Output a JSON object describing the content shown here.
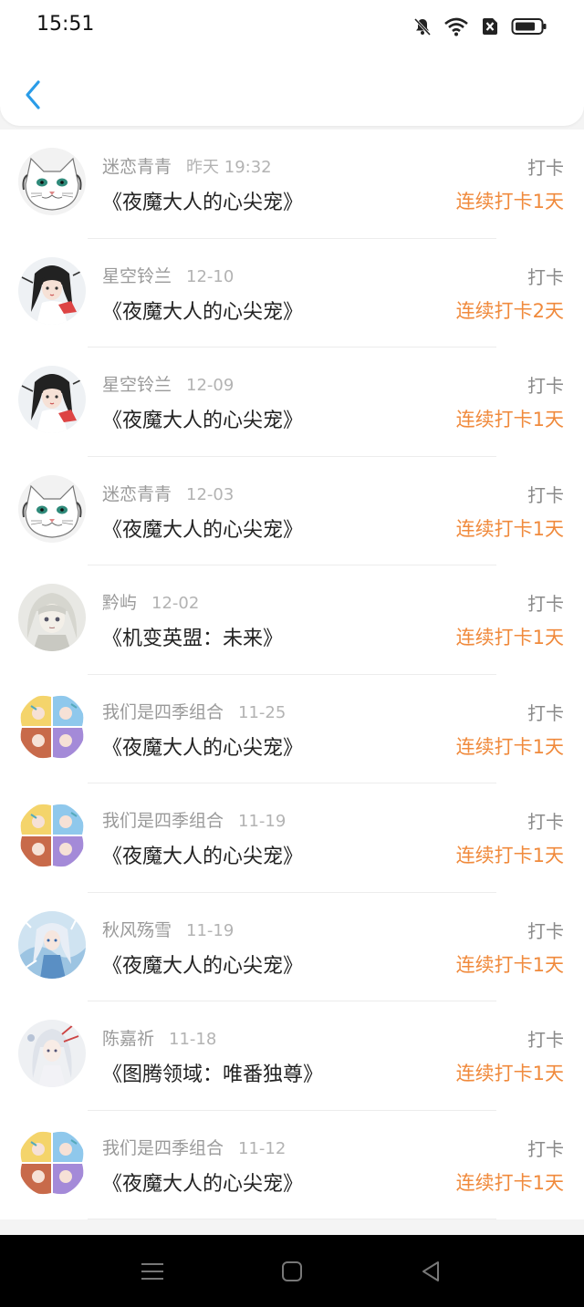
{
  "status_bar": {
    "time": "15:51",
    "icons": [
      "bell-muted-icon",
      "wifi-icon",
      "sim-x-icon",
      "battery-icon"
    ]
  },
  "header": {
    "back_icon": "chevron-left-icon",
    "accent": "#2a9ce8"
  },
  "entries": [
    {
      "user": "迷恋青青",
      "date": "昨天 19:32",
      "book": "《夜魔大人的心尖宠》",
      "action": "打卡",
      "streak": "连续打卡1天",
      "avatar": "white-cat"
    },
    {
      "user": "星空铃兰",
      "date": "12-10",
      "book": "《夜魔大人的心尖宠》",
      "action": "打卡",
      "streak": "连续打卡2天",
      "avatar": "anime-girl"
    },
    {
      "user": "星空铃兰",
      "date": "12-09",
      "book": "《夜魔大人的心尖宠》",
      "action": "打卡",
      "streak": "连续打卡1天",
      "avatar": "anime-girl"
    },
    {
      "user": "迷恋青青",
      "date": "12-03",
      "book": "《夜魔大人的心尖宠》",
      "action": "打卡",
      "streak": "连续打卡1天",
      "avatar": "white-cat"
    },
    {
      "user": "黔屿",
      "date": "12-02",
      "book": "《机变英盟：未来》",
      "action": "打卡",
      "streak": "连续打卡1天",
      "avatar": "white-hair"
    },
    {
      "user": "我们是四季组合",
      "date": "11-25",
      "book": "《夜魔大人的心尖宠》",
      "action": "打卡",
      "streak": "连续打卡1天",
      "avatar": "four-seasons"
    },
    {
      "user": "我们是四季组合",
      "date": "11-19",
      "book": "《夜魔大人的心尖宠》",
      "action": "打卡",
      "streak": "连续打卡1天",
      "avatar": "four-seasons"
    },
    {
      "user": "秋风殇雪",
      "date": "11-19",
      "book": "《夜魔大人的心尖宠》",
      "action": "打卡",
      "streak": "连续打卡1天",
      "avatar": "blue-girl"
    },
    {
      "user": "陈嘉祈",
      "date": "11-18",
      "book": "《图腾领域：唯番独尊》",
      "action": "打卡",
      "streak": "连续打卡1天",
      "avatar": "silver-girl"
    },
    {
      "user": "我们是四季组合",
      "date": "11-12",
      "book": "《夜魔大人的心尖宠》",
      "action": "打卡",
      "streak": "连续打卡1天",
      "avatar": "four-seasons"
    }
  ],
  "colors": {
    "streak": "#f08a3c",
    "username": "#9a9a9a",
    "title": "#222222"
  },
  "nav": {
    "icons": [
      "menu-icon",
      "home-square-icon",
      "back-triangle-icon"
    ]
  }
}
